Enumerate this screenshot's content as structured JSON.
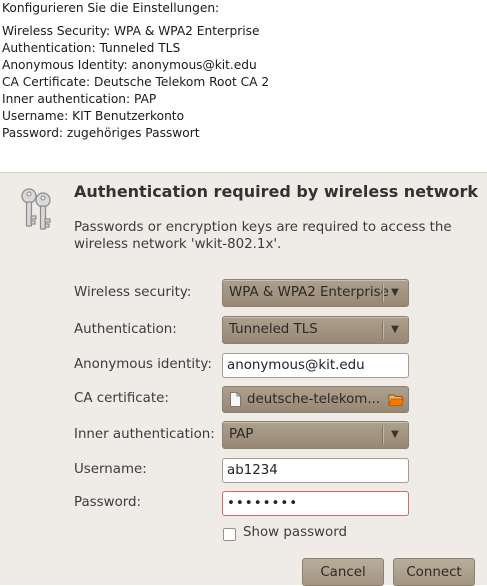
{
  "instructions": {
    "heading": "Konfigurieren Sie die Einstellungen:",
    "lines": [
      "Wireless Security: WPA & WPA2 Enterprise",
      "Authentication: Tunneled TLS",
      "Anonymous Identity: anonymous@kit.edu",
      "CA Certificate: Deutsche Telekom Root CA 2",
      "Inner authentication: PAP",
      "Username: KIT Benutzerkonto",
      "Password: zugehöriges Passwort"
    ]
  },
  "dialog": {
    "title": "Authentication required by wireless network",
    "description": "Passwords or encryption keys are required to access the wireless network 'wkit-802.1x'.",
    "icon": "keys-icon",
    "fields": {
      "wireless_security": {
        "label": "Wireless security:",
        "value": "WPA & WPA2 Enterprise"
      },
      "authentication": {
        "label": "Authentication:",
        "value": "Tunneled TLS"
      },
      "anonymous_identity": {
        "label": "Anonymous identity:",
        "value": "anonymous@kit.edu"
      },
      "ca_certificate": {
        "label": "CA certificate:",
        "value": "deutsche-telekom..."
      },
      "inner_authentication": {
        "label": "Inner authentication:",
        "value": "PAP"
      },
      "username": {
        "label": "Username:",
        "value": "ab1234"
      },
      "password": {
        "label": "Password:",
        "value": "••••••••"
      }
    },
    "show_password_label": "Show password",
    "show_password_checked": false,
    "buttons": {
      "cancel": "Cancel",
      "connect": "Connect"
    }
  },
  "colors": {
    "dialog_bg": "#efebe7",
    "combo_bg": "#a3957f",
    "password_border": "#d26a6a"
  }
}
